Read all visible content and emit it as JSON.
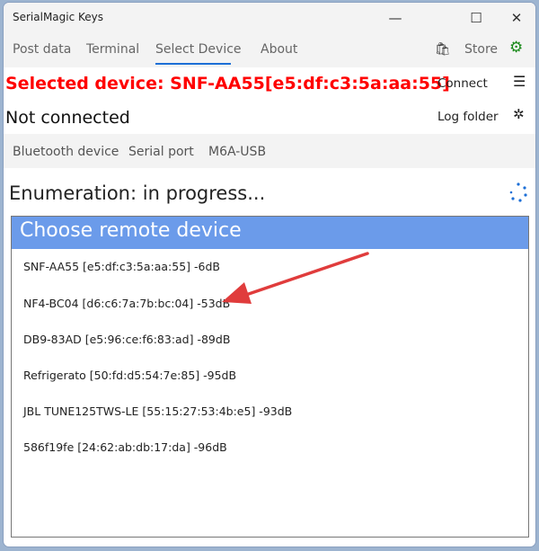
{
  "window": {
    "title": "SerialMagic Keys",
    "minimize": "—",
    "maximize": "☐",
    "close": "✕"
  },
  "nav": {
    "tabs": [
      {
        "label": "Post data"
      },
      {
        "label": "Terminal"
      },
      {
        "label": "Select Device"
      },
      {
        "label": "About"
      }
    ],
    "active": "Select Device",
    "store_label": "Store"
  },
  "status": {
    "selected_device": "Selected device: SNF-AA55[e5:df:c3:5a:aa:55]",
    "connection": "Not connected",
    "selected_color": "#ff0000"
  },
  "actions": {
    "connect": "Connect",
    "log_folder": "Log folder"
  },
  "subtabs": [
    {
      "label": "Bluetooth device"
    },
    {
      "label": "Serial port"
    },
    {
      "label": "M6A-USB"
    }
  ],
  "enumeration": "Enumeration: in progress...",
  "list": {
    "header": "Choose remote device",
    "items": [
      "SNF-AA55 [e5:df:c3:5a:aa:55] -6dB",
      "NF4-BC04 [d6:c6:7a:7b:bc:04] -53dB",
      "DB9-83AD [e5:96:ce:f6:83:ad] -89dB",
      "Refrigerato [50:fd:d5:54:7e:85] -95dB",
      "JBL TUNE125TWS-LE [55:15:27:53:4b:e5] -93dB",
      "586f19fe [24:62:ab:db:17:da] -96dB"
    ]
  }
}
